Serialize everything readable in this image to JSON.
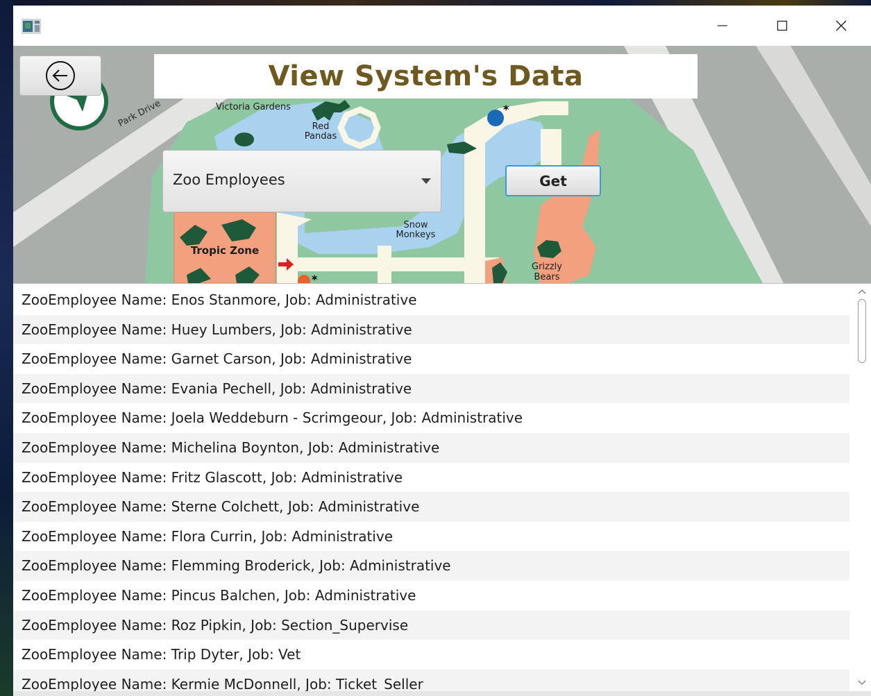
{
  "window": {
    "controls": {
      "minimize": "minimize",
      "maximize": "maximize",
      "close": "close"
    }
  },
  "header": {
    "title": "View System's Data"
  },
  "map": {
    "labels": {
      "park_drive": "Park Drive",
      "victoria_gardens": "Victoria Gardens",
      "red_pandas_1": "Red",
      "red_pandas_2": "Pandas",
      "snow_monkeys_1": "Snow",
      "snow_monkeys_2": "Monkeys",
      "tropic_zone": "Tropic Zone",
      "grizzly_1": "Grizzly",
      "grizzly_2": "Bears"
    }
  },
  "controls": {
    "dropdown": {
      "selected": "Zoo Employees"
    },
    "get_label": "Get"
  },
  "list": {
    "items": [
      "ZooEmployee Name: Enos Stanmore, Job: Administrative",
      "ZooEmployee Name: Huey Lumbers, Job: Administrative",
      "ZooEmployee Name: Garnet Carson, Job: Administrative",
      "ZooEmployee Name: Evania Pechell, Job: Administrative",
      "ZooEmployee Name: Joela Weddeburn - Scrimgeour, Job: Administrative",
      "ZooEmployee Name: Michelina Boynton, Job: Administrative",
      "ZooEmployee Name: Fritz Glascott, Job: Administrative",
      "ZooEmployee Name: Sterne Colchett, Job: Administrative",
      "ZooEmployee Name: Flora Currin, Job: Administrative",
      "ZooEmployee Name: Flemming Broderick, Job: Administrative",
      "ZooEmployee Name: Pincus Balchen, Job: Administrative",
      "ZooEmployee Name: Roz Pipkin, Job: Section_Supervise",
      "ZooEmployee Name: Trip Dyter, Job: Vet",
      "ZooEmployee Name: Kermie McDonnell, Job: Ticket_Seller"
    ]
  },
  "colors": {
    "title": "#6e5a1f",
    "accent": "#3b9ad9",
    "map_green": "#8fc7a0",
    "map_water": "#a8d2ee",
    "map_orange": "#f2a07e",
    "animal_green": "#1e5a3a"
  }
}
